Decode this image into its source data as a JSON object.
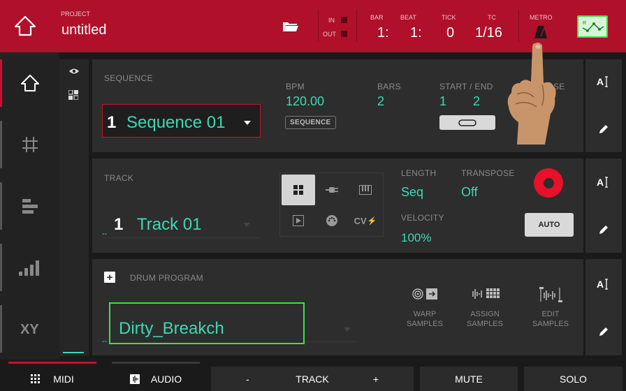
{
  "topbar": {
    "project_label": "PROJECT",
    "project_name": "untitled",
    "in_label": "IN",
    "out_label": "OUT",
    "bar_label": "BAR",
    "bar_value": "1:",
    "beat_label": "BEAT",
    "beat_value": "1:",
    "tick_label": "TICK",
    "tick_value": "0",
    "tc_label": "TC",
    "tc_value": "1/16",
    "metro_label": "METRO"
  },
  "sequence": {
    "label": "SEQUENCE",
    "number": "1",
    "name": "Sequence 01",
    "bpm_label": "BPM",
    "bpm_value": "120.00",
    "bpm_mode": "SEQUENCE",
    "bars_label": "BARS",
    "bars_value": "2",
    "start_end_label": "START / END",
    "start_value": "1",
    "end_value": "2",
    "loop_label": "LOOP",
    "loop_value": "SE"
  },
  "track": {
    "label": "TRACK",
    "number": "1",
    "name": "Track 01",
    "dash": "--",
    "cv_label": "CV",
    "length_label": "LENGTH",
    "length_value": "Seq",
    "transpose_label": "TRANSPOSE",
    "transpose_value": "Off",
    "velocity_label": "VELOCITY",
    "velocity_value": "100%",
    "auto_label": "AUTO"
  },
  "program": {
    "label": "DRUM PROGRAM",
    "name": "Dirty_Breakch",
    "dash": "--",
    "warp_line1": "WARP",
    "warp_line2": "SAMPLES",
    "assign_line1": "ASSIGN",
    "assign_line2": "SAMPLES",
    "edit_line1": "EDIT",
    "edit_line2": "SAMPLES"
  },
  "bottombar": {
    "midi": "MIDI",
    "audio": "AUDIO",
    "minus": "-",
    "track": "TRACK",
    "plus": "+",
    "mute": "MUTE",
    "solo": "SOLO"
  },
  "colors": {
    "accent_red": "#b0102a",
    "teal": "#3fd8b5",
    "green_box": "#3ee04a",
    "record_red": "#e8102a"
  }
}
